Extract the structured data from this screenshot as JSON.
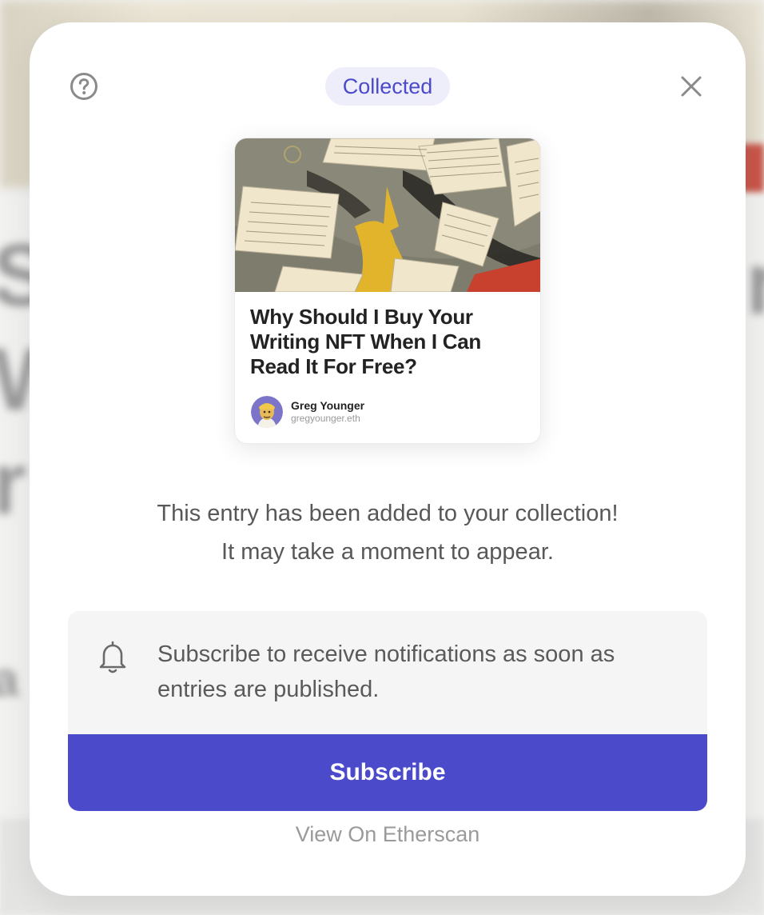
{
  "modal": {
    "badge": "Collected",
    "help_icon": "question-circle-icon",
    "close_icon": "close-icon"
  },
  "entry": {
    "title": "Why Should I Buy Your Writing NFT When I Can Read It For Free?",
    "author_name": "Greg Younger",
    "author_handle": "gregyounger.eth"
  },
  "message": {
    "line1": "This entry has been added to your collection!",
    "line2": "It may take a moment to appear."
  },
  "subscribe": {
    "icon": "bell-icon",
    "text": "Subscribe to receive notifications as soon as entries are published.",
    "button_label": "Subscribe"
  },
  "footer": {
    "etherscan_label": "View On Etherscan"
  },
  "colors": {
    "accent": "#4b4acb",
    "badge_bg": "#eeeefa",
    "panel_bg": "#f5f5f5"
  }
}
